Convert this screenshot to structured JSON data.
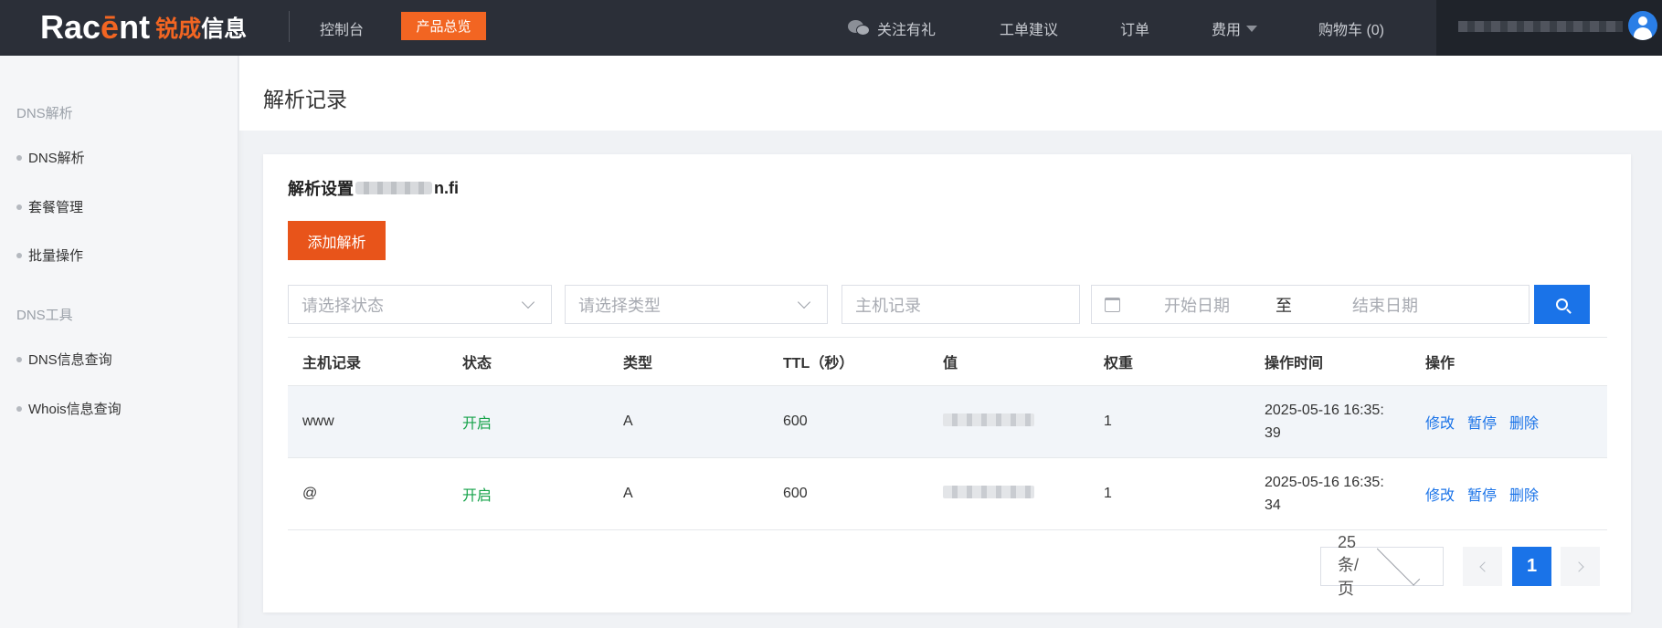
{
  "header": {
    "logo_en_pre": "Rac",
    "logo_en_accent": "ē",
    "logo_en_post": "nt",
    "logo_cn_accent": "锐成",
    "logo_cn_post": "信息",
    "console": "控制台",
    "product_overview": "产品总览",
    "wechat": "关注有礼",
    "ticket": "工单建议",
    "order": "订单",
    "fee": "费用",
    "cart": "购物车 (0)"
  },
  "sidebar": {
    "group1": "DNS解析",
    "items1": [
      "DNS解析",
      "套餐管理",
      "批量操作"
    ],
    "group2": "DNS工具",
    "items2": [
      "DNS信息查询",
      "Whois信息查询"
    ]
  },
  "page": {
    "title": "解析记录"
  },
  "card": {
    "title_prefix": "解析设置",
    "title_suffix": "n.fi",
    "add_button": "添加解析"
  },
  "filters": {
    "status_placeholder": "请选择状态",
    "type_placeholder": "请选择类型",
    "host_placeholder": "主机记录",
    "date_start": "开始日期",
    "date_sep": "至",
    "date_end": "结束日期"
  },
  "table": {
    "headers": [
      "主机记录",
      "状态",
      "类型",
      "TTL（秒）",
      "值",
      "权重",
      "操作时间",
      "操作"
    ],
    "rows": [
      {
        "host": "www",
        "status": "开启",
        "type": "A",
        "ttl": "600",
        "weight": "1",
        "time_line1": "2025-05-16 16:35:",
        "time_line2": "39"
      },
      {
        "host": "@",
        "status": "开启",
        "type": "A",
        "ttl": "600",
        "weight": "1",
        "time_line1": "2025-05-16 16:35:",
        "time_line2": "34"
      }
    ],
    "actions": [
      "修改",
      "暂停",
      "删除"
    ]
  },
  "pagination": {
    "page_size": "25条/页",
    "current": "1"
  },
  "colors": {
    "accent": "#f26522",
    "primary": "#1a73e8",
    "enabled": "#16a34a"
  }
}
